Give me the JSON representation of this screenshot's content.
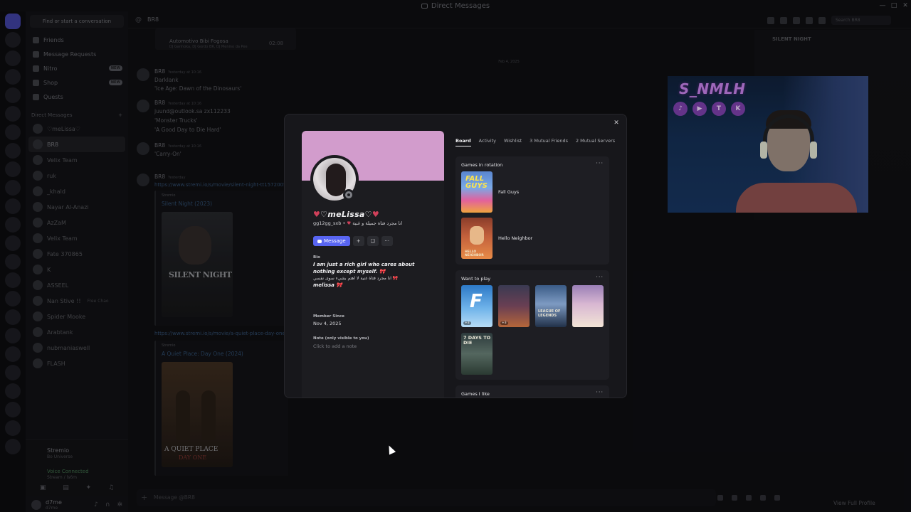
{
  "window": {
    "title": "Direct Messages",
    "controls": [
      "—",
      "□",
      "✕"
    ]
  },
  "sidebar": {
    "search_placeholder": "Find or start a conversation",
    "nav": [
      {
        "label": "Friends",
        "badge": ""
      },
      {
        "label": "Message Requests",
        "badge": ""
      },
      {
        "label": "Nitro",
        "badge": "NEW"
      },
      {
        "label": "Shop",
        "badge": "NEW"
      },
      {
        "label": "Quests",
        "badge": ""
      }
    ],
    "dm_header": "Direct Messages",
    "dm_header_plus": "+",
    "dms": [
      {
        "name": "♡meLissa♡",
        "sub": ""
      },
      {
        "name": "BR8",
        "sub": ""
      },
      {
        "name": "Velix Team",
        "sub": ""
      },
      {
        "name": "ruk",
        "sub": ""
      },
      {
        "name": "_khald",
        "sub": ""
      },
      {
        "name": "Nayar Al-Anazi",
        "sub": ""
      },
      {
        "name": "AzZaM",
        "sub": ""
      },
      {
        "name": "Velix Team",
        "sub": ""
      },
      {
        "name": "Fate 370865",
        "sub": ""
      },
      {
        "name": "K",
        "sub": ""
      },
      {
        "name": "ASSEEL",
        "sub": ""
      },
      {
        "name": "Nan Stive !!",
        "sub": "Free Chao"
      },
      {
        "name": "Spider Mooke",
        "sub": ""
      },
      {
        "name": "Arabtank",
        "sub": ""
      },
      {
        "name": "nubmaniaswell",
        "sub": ""
      },
      {
        "name": "FLASH",
        "sub": ""
      }
    ],
    "stream": {
      "name": "Stremio",
      "sub": "Bo Universe",
      "voice": "Voice Connected",
      "voice_sub": "Stream / ls6m"
    },
    "user": {
      "name": "d7me",
      "status": "d7me"
    }
  },
  "chat": {
    "header_name": "BR8",
    "search_placeholder": "Search BR8",
    "stream_title": "SILENT NIGHT",
    "embed_top": {
      "title": "Automotivo Bibi Fogosa",
      "sub": "DJ Ganhoka, DJ Gordo BR, DJ Menino da Pee",
      "time": "02:08"
    },
    "divider": "Feb 4, 2025",
    "messages": [
      {
        "author": "BR8",
        "time": "Yesterday at 10:16",
        "lines": [
          "Darklank",
          "'Ice Age: Dawn of the Dinosaurs'"
        ]
      },
      {
        "author": "BR8",
        "time": "Yesterday at 10:16",
        "lines": [
          "juund@outlook.sa zx112233",
          "'Monster Trucks'",
          "'A Good Day to Die Hard'"
        ]
      },
      {
        "author": "BR8",
        "time": "Yesterday at 10:16",
        "lines": [
          "'Carry-On'"
        ]
      },
      {
        "author": "BR8",
        "time": "Yesterday",
        "lines": []
      }
    ],
    "links": [
      "https://www.stremi.io/s/movie/silent-night-tt15720056",
      "https://www.stremi.io/s/movie/a-quiet-place-day-one"
    ],
    "embeds": [
      {
        "provider": "Stremio",
        "title": "Silent Night (2023)",
        "poster_text": "SILENT NIGHT"
      },
      {
        "provider": "Stremio",
        "title": "A Quiet Place: Day One (2024)",
        "poster_text": "A QUIET PLACE",
        "poster_text2": "DAY ONE"
      }
    ],
    "composer_placeholder": "Message @BR8",
    "view_full_profile": "View Full Profile"
  },
  "webcam": {
    "name": "S_NMLH",
    "socials": [
      "tiktok",
      "youtube",
      "twitch",
      "kick"
    ],
    "social_glyphs": [
      "♪",
      "▶",
      "T",
      "K"
    ]
  },
  "profile": {
    "display_name": "♡meLissa♡",
    "heart_glyph": "♥",
    "username": "gg12gg_sxb",
    "dot": "•",
    "arabic_status": "انا مجرد فتاة جميلة و غنية",
    "buttons": {
      "message": "Message",
      "add_friend": "+",
      "gift": "❏",
      "more": "···"
    },
    "bio_label": "Bio",
    "bio_line1": "I am just a rich girl who cares about nothing except myself.",
    "bio_line2": "انا مجرد فتاة غنية لا اهتم بشيء سوى نفسي",
    "bio_line3": "melissa",
    "member_label": "Member Since",
    "member_since": "Nov 4, 2025",
    "note_label": "Note (only visible to you)",
    "note_placeholder": "Click to add a note",
    "tabs": [
      "Board",
      "Activity",
      "Wishlist",
      "3 Mutual Friends",
      "2 Mutual Servers"
    ],
    "games_rotation": {
      "title": "Games in rotation",
      "items": [
        {
          "name": "Fall Guys",
          "art_text": "FALL GUYS"
        },
        {
          "name": "Hello Neighbor",
          "art_text": "HELLO NEIGHBOR"
        }
      ]
    },
    "want_to_play": {
      "title": "Want to play",
      "items": [
        {
          "icon": "fortnite",
          "art_text": "F",
          "players": "+3"
        },
        {
          "icon": "dota",
          "players": "+3"
        },
        {
          "icon": "league",
          "art_text": "LEAGUE OF LEGENDS",
          "players": ""
        },
        {
          "icon": "genshin",
          "players": ""
        },
        {
          "icon": "7days",
          "art_text": "7 DAYS TO DIE",
          "players": ""
        }
      ]
    },
    "games_like": {
      "title": "Games I like"
    },
    "more_glyph": "···",
    "close_glyph": "✕"
  },
  "colors": {
    "blurple": "#5865f2",
    "banner": "#d29ccc",
    "accent_pink": "#d0405a"
  }
}
